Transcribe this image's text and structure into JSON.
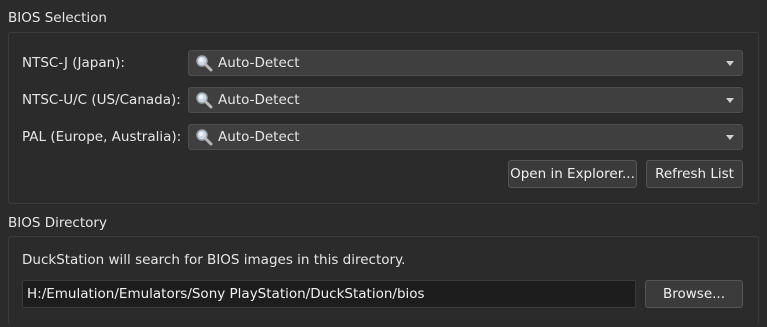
{
  "bios_selection": {
    "title": "BIOS Selection",
    "rows": [
      {
        "label": "NTSC-J (Japan):",
        "value": "Auto-Detect"
      },
      {
        "label": "NTSC-U/C (US/Canada):",
        "value": "Auto-Detect"
      },
      {
        "label": "PAL (Europe, Australia):",
        "value": "Auto-Detect"
      }
    ],
    "open_in_explorer_label": "Open in Explorer...",
    "refresh_list_label": "Refresh List",
    "combo_icon": "magnifier-icon",
    "dropdown_icon": "chevron-down-icon"
  },
  "bios_directory": {
    "title": "BIOS Directory",
    "description": "DuckStation will search for BIOS images in this directory.",
    "path": "H:/Emulation/Emulators/Sony PlayStation/DuckStation/bios",
    "browse_label": "Browse..."
  },
  "colors": {
    "background": "#2b2b2b",
    "combo_bg": "#3f3f3f",
    "field_bg": "#1d1d1d",
    "button_bg": "#3b3b3b",
    "border": "#3c3c3c"
  }
}
